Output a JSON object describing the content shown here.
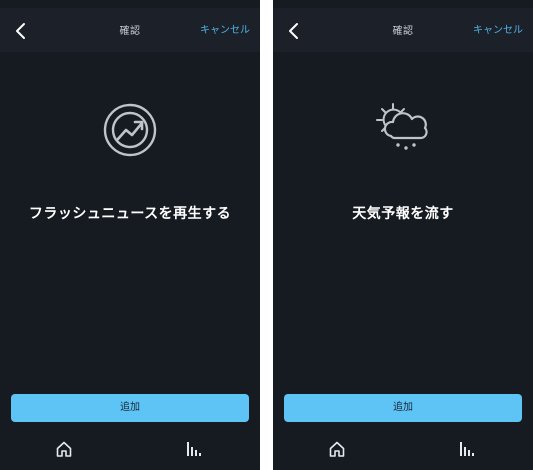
{
  "screens": [
    {
      "header": {
        "back_icon": "chevron-left-icon",
        "title": "確認",
        "cancel_label": "キャンセル"
      },
      "hero": {
        "icon": "flash-briefing-icon",
        "title": "フラッシュニュースを再生する"
      },
      "add_button_label": "追加",
      "tabbar": {
        "home_icon": "home-icon",
        "activity_icon": "activity-icon"
      }
    },
    {
      "header": {
        "back_icon": "chevron-left-icon",
        "title": "確認",
        "cancel_label": "キャンセル"
      },
      "hero": {
        "icon": "weather-icon",
        "title": "天気予報を流す"
      },
      "add_button_label": "追加",
      "tabbar": {
        "home_icon": "home-icon",
        "activity_icon": "activity-icon"
      }
    }
  ],
  "colors": {
    "background": "#161b22",
    "header": "#1c2129",
    "accent": "#4fb3e8",
    "button": "#5ec3f5",
    "text_primary": "#ffffff",
    "text_secondary": "#c9ced6"
  }
}
